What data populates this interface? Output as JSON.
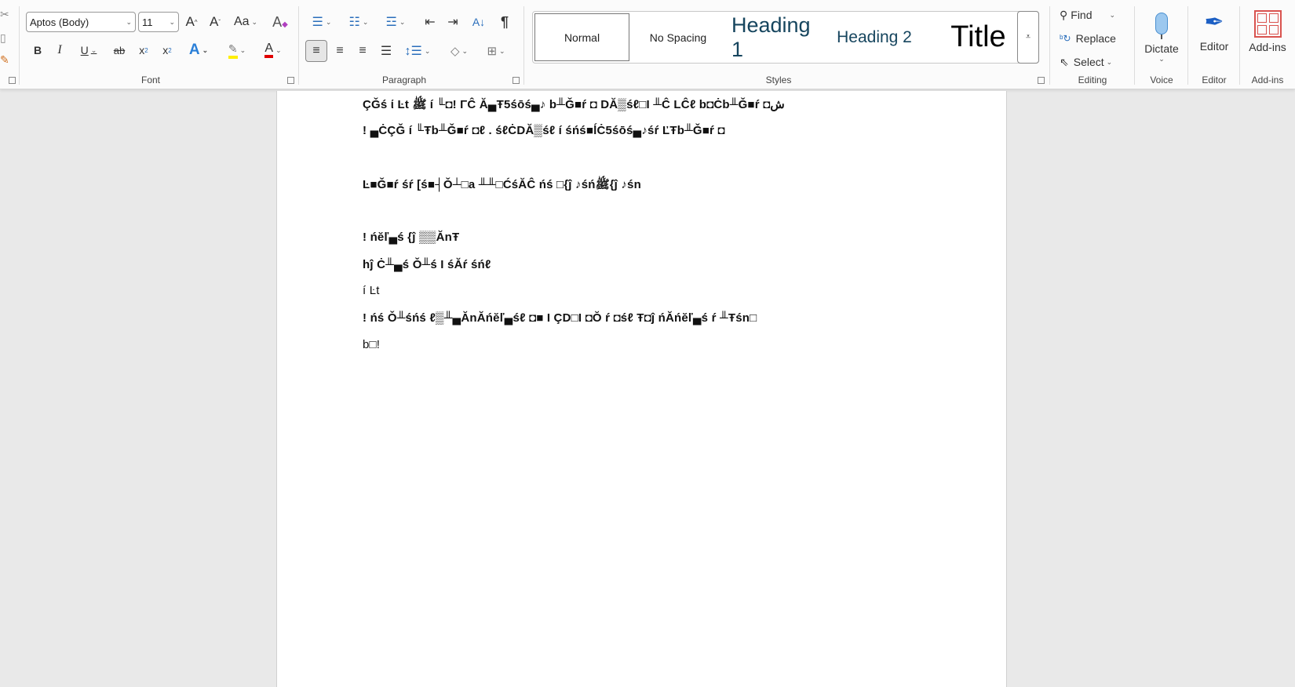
{
  "ribbon": {
    "font": {
      "group_label": "Font",
      "font_name": "Aptos (Body)",
      "font_size": "11",
      "grow": "A",
      "shrink": "A",
      "change_case": "Aa",
      "bold": "B",
      "italic": "I",
      "underline": "U",
      "strike": "ab",
      "subscript": "x",
      "superscript": "x",
      "text_effects": "A",
      "font_color": "A",
      "highlight_color": "#ffff00",
      "font_color_value": "#e00000"
    },
    "paragraph": {
      "group_label": "Paragraph",
      "pilcrow": "¶"
    },
    "styles": {
      "group_label": "Styles",
      "items": [
        "Normal",
        "No Spacing",
        "Heading 1",
        "Heading 2",
        "Title"
      ]
    },
    "editing": {
      "group_label": "Editing",
      "find": "Find",
      "replace": "Replace",
      "select": "Select"
    },
    "voice": {
      "group_label": "Voice",
      "dictate": "Dictate"
    },
    "editor": {
      "group_label": "Editor",
      "editor": "Editor"
    },
    "addins": {
      "group_label": "Add-ins",
      "addins": "Add-ins"
    }
  },
  "document": {
    "lines": [
      "ÇǦś ί Ŀt ﷺ í ╙◘! ΓĈ Ă▄Ŧ5śōś▄♪ b╨Ǧ■ŕ ◘ DĂ▒śℓ□І ╨Ĉ LĈℓ b◘Ċb╨Ǧ■ŕ ◘ش",
      "! ▄ĊÇǦ í ╙Ŧb╨Ǧ■ŕ ◘ℓ . śℓĊDĂ▒śℓ í śńś■ĺĊ5śōś▄♪śŕ ĽŦb╨Ǧ■ŕ ◘",
      "Ŀ■Ǧ■ŕ śŕ [ś■┤Ǒ┴□a ╨╨□ĆśĂĈ ńś □{ĵ ♪śńﷺ{ĵ ♪śn",
      "! ńĕľ▄ś {ĵ ▒▒ĂnŦ",
      "hĵ Ċ╨▄ś Ǒ╨ś I śĂŕ śńℓ",
      "í Ŀt",
      "! ńś Ǒ╨śńś ℓ▒╨▄ĂnĂńĕľ▄śℓ ◘■ I ÇD□I ◘Ŏ ŕ ◘śℓ Ŧ◘ĵ ńĂńĕľ▄ś ŕ ╨Ŧśn□",
      "b□!"
    ]
  }
}
